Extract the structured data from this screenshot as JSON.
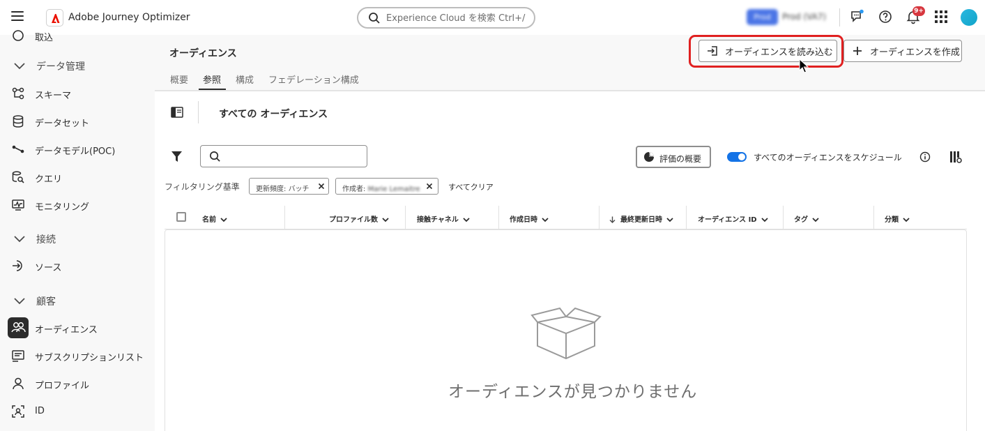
{
  "app": {
    "title": "Adobe Journey Optimizer"
  },
  "header": {
    "search_placeholder": "Experience Cloud を検索 Ctrl+/",
    "org_badge": "Prod",
    "org_name": "Prod (VA7)",
    "notification_count": "9+"
  },
  "sidebar": {
    "items": [
      {
        "label": "取込",
        "type": "item",
        "icon": "globe-icon"
      },
      {
        "label": "データ管理",
        "type": "section",
        "icon": "chevron-down-icon"
      },
      {
        "label": "スキーマ",
        "type": "item",
        "icon": "schema-icon"
      },
      {
        "label": "データセット",
        "type": "item",
        "icon": "dataset-icon"
      },
      {
        "label": "データモデル(POC)",
        "type": "item",
        "icon": "data-model-icon"
      },
      {
        "label": "クエリ",
        "type": "item",
        "icon": "query-icon"
      },
      {
        "label": "モニタリング",
        "type": "item",
        "icon": "monitoring-icon"
      },
      {
        "label": "接続",
        "type": "section",
        "icon": "chevron-down-icon"
      },
      {
        "label": "ソース",
        "type": "item",
        "icon": "source-icon"
      },
      {
        "label": "顧客",
        "type": "section",
        "icon": "chevron-down-icon"
      },
      {
        "label": "オーディエンス",
        "type": "item",
        "icon": "audience-icon",
        "active": true
      },
      {
        "label": "サブスクリプションリスト",
        "type": "item",
        "icon": "subscription-list-icon"
      },
      {
        "label": "プロファイル",
        "type": "item",
        "icon": "profile-icon"
      },
      {
        "label": "ID",
        "type": "item",
        "icon": "identity-icon"
      }
    ]
  },
  "page": {
    "title": "オーディエンス",
    "import_button": "オーディエンスを読み込む",
    "create_button": "オーディエンスを作成",
    "tabs": [
      "概要",
      "参照",
      "構成",
      "フェデレーション構成"
    ],
    "active_tab": "参照"
  },
  "content": {
    "title": "すべての オーディエンス",
    "eval_button": "評価の概要",
    "schedule_toggle_label": "すべてのオーディエンスをスケジュール",
    "schedule_toggle_on": true,
    "filter_label": "フィルタリング基準",
    "chips": [
      {
        "prefix": "更新頻度: ",
        "value": "バッチ"
      },
      {
        "prefix": "作成者: ",
        "value": "Marie Lemaitre"
      }
    ],
    "clear_all": "すべてクリア",
    "columns": [
      "名前",
      "プロファイル数",
      "接触チャネル",
      "作成日時",
      "最終更新日時",
      "オーディエンス ID",
      "タグ",
      "分類"
    ],
    "sorted_column": "最終更新日時",
    "empty_message": "オーディエンスが見つかりません"
  },
  "colors": {
    "accent": "#1473e6",
    "highlight": "#e02020",
    "badge": "#d7373f"
  }
}
